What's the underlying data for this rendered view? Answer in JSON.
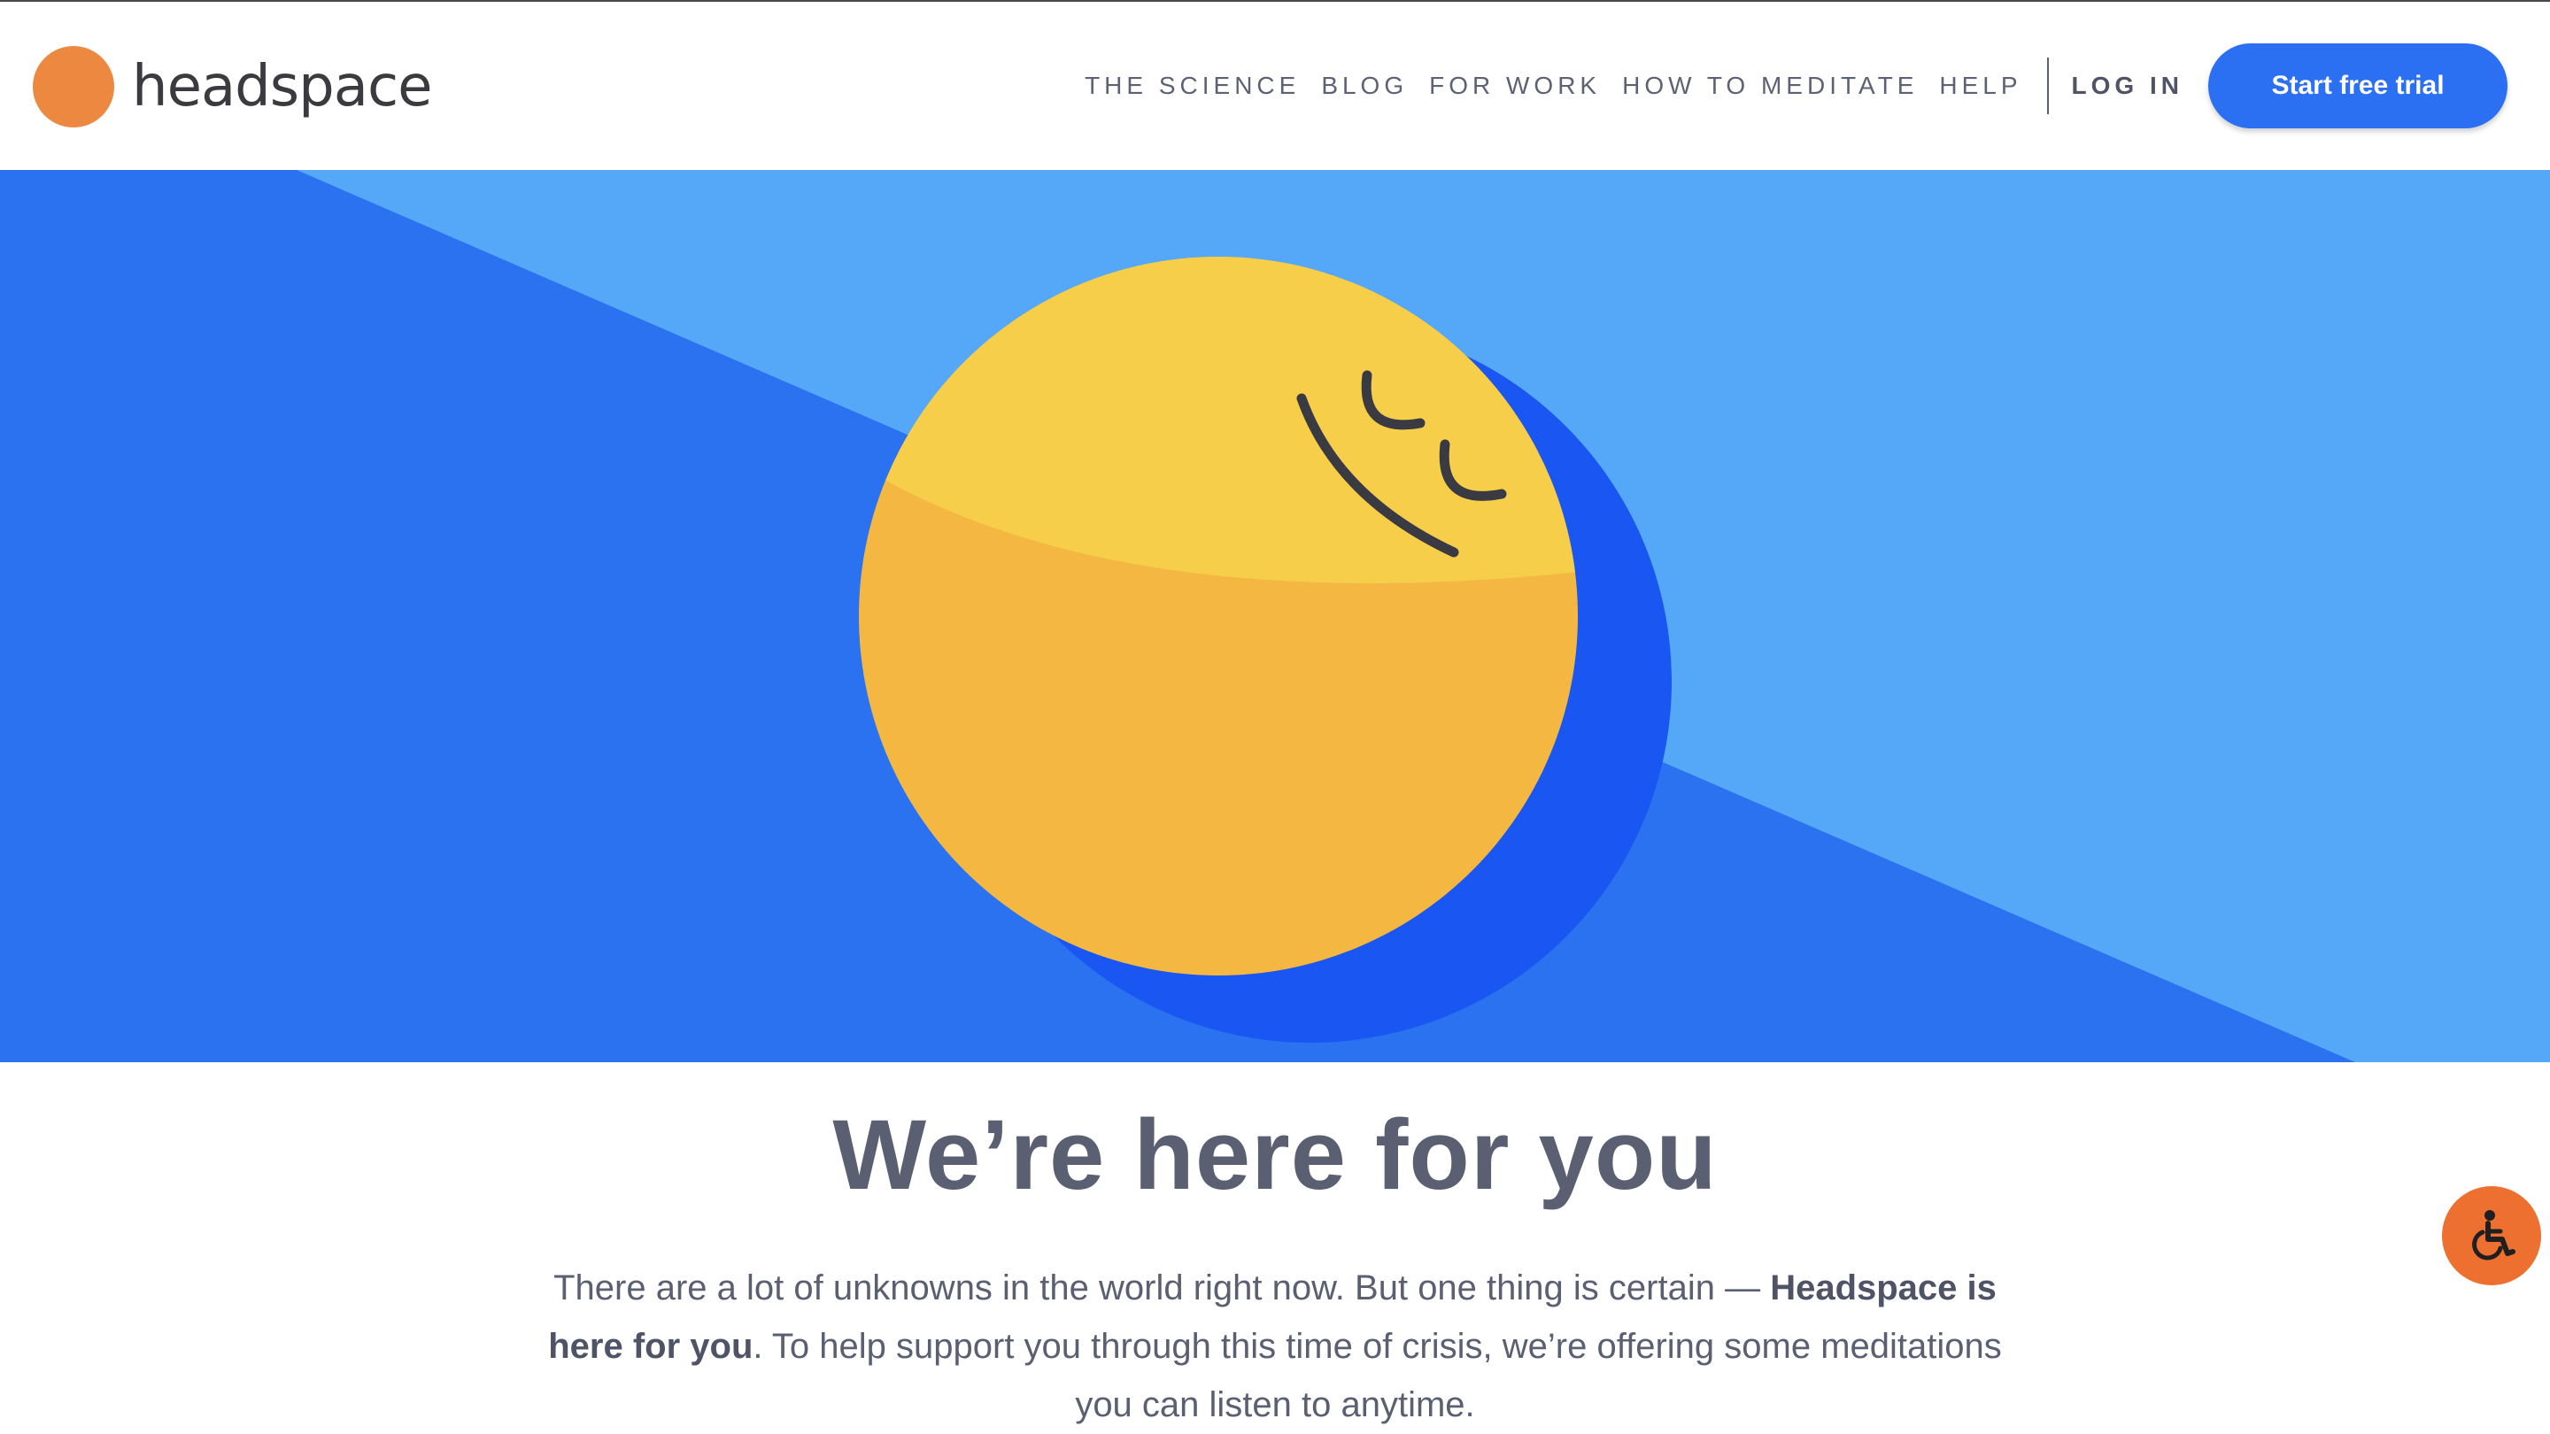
{
  "brand": {
    "name": "headspace",
    "logo_color": "#ec8840"
  },
  "nav": {
    "links": [
      "THE SCIENCE",
      "BLOG",
      "FOR WORK",
      "HOW TO MEDITATE",
      "HELP"
    ],
    "login_label": "LOG IN",
    "cta_label": "Start free trial",
    "cta_color": "#2b6ff2"
  },
  "hero": {
    "illustration": "smiling-sun-illustration",
    "colors": {
      "light_blue": "#55a8f7",
      "blue": "#2a72ef",
      "shadow_blue": "#1a57f2",
      "sun_top": "#f7ce4a",
      "sun_bottom": "#f4b842",
      "face": "#3a3a42"
    }
  },
  "content": {
    "headline": "We’re here for you",
    "intro_part1": "There are a lot of unknowns in the world right now. But one thing is certain — ",
    "intro_bold": "Headspace is here for you",
    "intro_part2": ". To help support you through this time of crisis, we’re offering some meditations you can listen to anytime."
  },
  "accessibility": {
    "icon": "wheelchair-icon",
    "color": "#ee7030"
  }
}
